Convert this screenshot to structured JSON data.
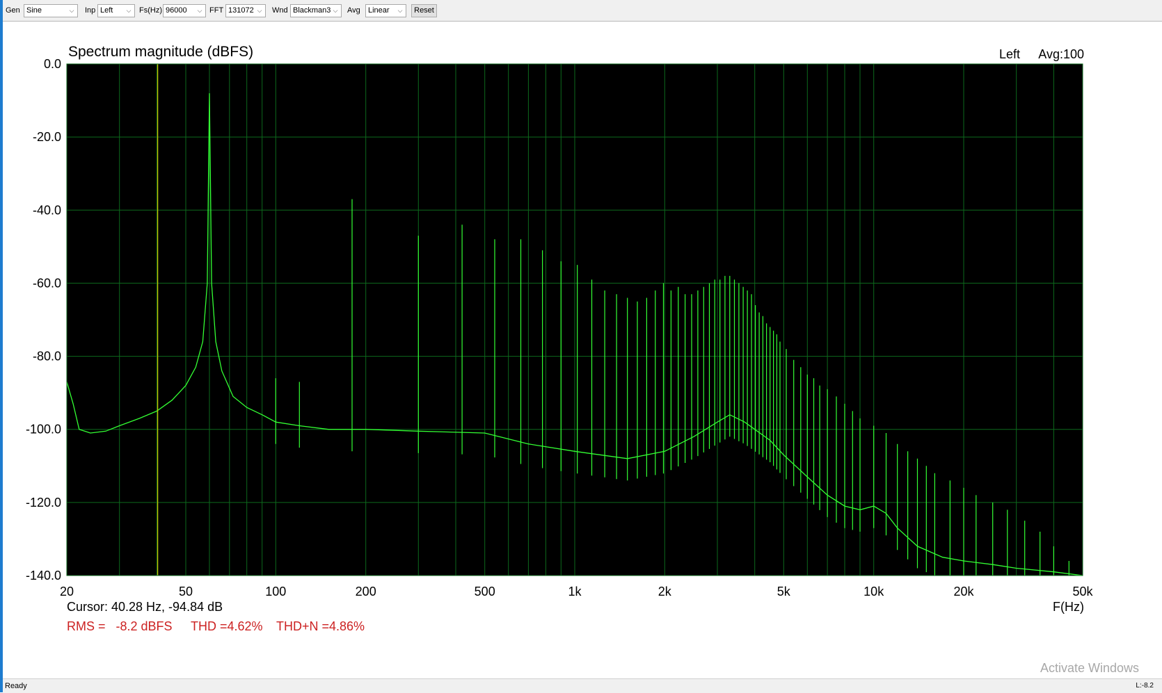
{
  "toolbar": {
    "gen_label": "Gen",
    "gen_value": "Sine",
    "inp_label": "Inp",
    "inp_value": "Left",
    "fs_label": "Fs(Hz)",
    "fs_value": "96000",
    "fft_label": "FFT",
    "fft_value": "131072",
    "wnd_label": "Wnd",
    "wnd_value": "Blackman3",
    "avg_label": "Avg",
    "avg_value": "Linear",
    "reset_label": "Reset"
  },
  "status": {
    "text": "Ready",
    "level": "L:-8.2"
  },
  "watermark": "Activate Windows",
  "readouts": {
    "channel": "Left",
    "avg": "Avg:100",
    "cursor": "Cursor: 40.28 Hz, -94.84 dB",
    "rms": "RMS =   -8.2 dBFS",
    "thd": "THD =4.62%",
    "thdn": "THD+N =4.86%"
  },
  "colors": {
    "plot_bg": "#000000",
    "grid": "#0d6a1c",
    "trace": "#33ff33",
    "cursor": "#c8c800",
    "readout_red": "#cc2222"
  },
  "chart_data": {
    "type": "line",
    "title": "Spectrum magnitude (dBFS)",
    "xlabel": "F(Hz)",
    "ylabel": "",
    "x_scale": "log",
    "xlim": [
      20,
      50000
    ],
    "ylim": [
      -140,
      0
    ],
    "grid": true,
    "x_ticks": [
      {
        "value": 20,
        "label": "20"
      },
      {
        "value": 50,
        "label": "50"
      },
      {
        "value": 100,
        "label": "100"
      },
      {
        "value": 200,
        "label": "200"
      },
      {
        "value": 500,
        "label": "500"
      },
      {
        "value": 1000,
        "label": "1k"
      },
      {
        "value": 2000,
        "label": "2k"
      },
      {
        "value": 5000,
        "label": "5k"
      },
      {
        "value": 10000,
        "label": "10k"
      },
      {
        "value": 20000,
        "label": "20k"
      },
      {
        "value": 50000,
        "label": "50k"
      }
    ],
    "y_ticks": [
      {
        "value": 0,
        "label": "0.0"
      },
      {
        "value": -20,
        "label": "-20.0"
      },
      {
        "value": -40,
        "label": "-40.0"
      },
      {
        "value": -60,
        "label": "-60.0"
      },
      {
        "value": -80,
        "label": "-80.0"
      },
      {
        "value": -100,
        "label": "-100.0"
      },
      {
        "value": -120,
        "label": "-120.0"
      },
      {
        "value": -140,
        "label": "-140.0"
      }
    ],
    "cursor_hz": 40.28,
    "fundamental_hz": 60,
    "noise_floor": [
      [
        20,
        -87
      ],
      [
        21,
        -93
      ],
      [
        22,
        -100
      ],
      [
        24,
        -101
      ],
      [
        27,
        -100.5
      ],
      [
        30,
        -99
      ],
      [
        35,
        -97
      ],
      [
        40,
        -95
      ],
      [
        45,
        -92
      ],
      [
        50,
        -88
      ],
      [
        54,
        -83
      ],
      [
        57,
        -76
      ],
      [
        59,
        -60
      ],
      [
        60,
        -8
      ],
      [
        61,
        -60
      ],
      [
        63,
        -76
      ],
      [
        66,
        -84
      ],
      [
        72,
        -91
      ],
      [
        80,
        -94
      ],
      [
        90,
        -96
      ],
      [
        100,
        -98
      ],
      [
        120,
        -99
      ],
      [
        150,
        -100
      ],
      [
        200,
        -100
      ],
      [
        300,
        -100.5
      ],
      [
        500,
        -101
      ],
      [
        700,
        -104
      ],
      [
        1000,
        -106
      ],
      [
        1500,
        -108
      ],
      [
        2000,
        -106
      ],
      [
        2500,
        -102
      ],
      [
        3000,
        -98
      ],
      [
        3300,
        -96
      ],
      [
        3700,
        -98
      ],
      [
        4500,
        -103
      ],
      [
        5000,
        -107
      ],
      [
        6000,
        -113
      ],
      [
        7000,
        -118
      ],
      [
        8000,
        -121
      ],
      [
        9000,
        -122
      ],
      [
        10000,
        -121
      ],
      [
        11000,
        -123
      ],
      [
        12000,
        -127
      ],
      [
        14000,
        -132
      ],
      [
        17000,
        -135
      ],
      [
        20000,
        -136
      ],
      [
        25000,
        -137
      ],
      [
        30000,
        -138
      ],
      [
        40000,
        -139
      ],
      [
        50000,
        -140
      ]
    ],
    "spurs": [
      [
        100,
        -86
      ],
      [
        120,
        -87
      ],
      [
        180,
        -37
      ],
      [
        300,
        -47
      ],
      [
        420,
        -44
      ],
      [
        540,
        -48
      ],
      [
        660,
        -48
      ],
      [
        780,
        -51
      ],
      [
        900,
        -54
      ],
      [
        1020,
        -55
      ],
      [
        1140,
        -59
      ],
      [
        1260,
        -62
      ],
      [
        1380,
        -63
      ],
      [
        1500,
        -64
      ],
      [
        1620,
        -65
      ],
      [
        1740,
        -64
      ],
      [
        1860,
        -62
      ],
      [
        1980,
        -60
      ],
      [
        2100,
        -62
      ],
      [
        2220,
        -61
      ],
      [
        2340,
        -63
      ],
      [
        2460,
        -63
      ],
      [
        2580,
        -62
      ],
      [
        2700,
        -61
      ],
      [
        2820,
        -60
      ],
      [
        2940,
        -59
      ],
      [
        3060,
        -59
      ],
      [
        3180,
        -58
      ],
      [
        3300,
        -58
      ],
      [
        3420,
        -59
      ],
      [
        3540,
        -60
      ],
      [
        3660,
        -61
      ],
      [
        3780,
        -62
      ],
      [
        3900,
        -63
      ],
      [
        4020,
        -66
      ],
      [
        4140,
        -68
      ],
      [
        4260,
        -69
      ],
      [
        4380,
        -71
      ],
      [
        4500,
        -72
      ],
      [
        4620,
        -73
      ],
      [
        4740,
        -74
      ],
      [
        4860,
        -76
      ],
      [
        5100,
        -78
      ],
      [
        5400,
        -81
      ],
      [
        5700,
        -83
      ],
      [
        6000,
        -85
      ],
      [
        6300,
        -86
      ],
      [
        6600,
        -88
      ],
      [
        7000,
        -89
      ],
      [
        7500,
        -91
      ],
      [
        8000,
        -93
      ],
      [
        8500,
        -95
      ],
      [
        9000,
        -97
      ],
      [
        10000,
        -99
      ],
      [
        11000,
        -101
      ],
      [
        12000,
        -104
      ],
      [
        13000,
        -106
      ],
      [
        14000,
        -108
      ],
      [
        15000,
        -110
      ],
      [
        16000,
        -112
      ],
      [
        18000,
        -114
      ],
      [
        20000,
        -116
      ],
      [
        22000,
        -118
      ],
      [
        25000,
        -120
      ],
      [
        28000,
        -122
      ],
      [
        32000,
        -125
      ],
      [
        36000,
        -128
      ],
      [
        40000,
        -132
      ],
      [
        45000,
        -136
      ]
    ]
  }
}
